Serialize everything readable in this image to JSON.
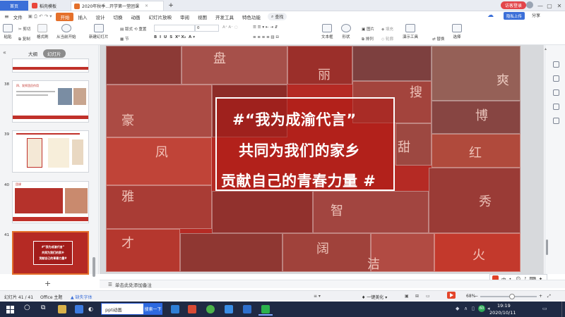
{
  "titlebar": {
    "home_tab": "首页",
    "template_tab": "稻壳模板",
    "doc_tab": "2020年秋季...开学第一堂团课",
    "add_tab": "+",
    "login_label": "访客登录"
  },
  "menubar": {
    "file": "文件",
    "items": [
      "开始",
      "插入",
      "设计",
      "切换",
      "动画",
      "幻灯片放映",
      "审阅",
      "视图",
      "开发工具",
      "特色功能"
    ],
    "search": "查找",
    "cloud": "隐私上传",
    "share": "分享"
  },
  "ribbon": {
    "paste": "粘贴",
    "cut": "剪切",
    "copy": "复制",
    "format_painter": "格式刷",
    "from_start": "从当前开始",
    "new_slide": "新建幻灯片",
    "layout": "版式",
    "section": "节",
    "reset": "重置",
    "font_size": "0",
    "text_box": "文本框",
    "shape": "形状",
    "arrange": "排列",
    "picture": "图片",
    "fill": "填充",
    "outline": "轮廓",
    "presentation_tools": "演示工具",
    "replace": "替换",
    "select": "选择"
  },
  "left_panel": {
    "outline_tab": "大纲",
    "slides_tab": "幻灯片",
    "slide_numbers": [
      "38",
      "39",
      "40",
      "41"
    ],
    "thumb38_title": "四、发挥团员作用",
    "thumb40_title": "团课",
    "thumb41_lines": [
      "#“我为成渝代言”",
      "共同为我们的家乡",
      "贡献自己的青春力量#"
    ]
  },
  "slide": {
    "line1": "#“我为成渝代言”",
    "line2": "共同为我们的家乡",
    "line3": "贡献自己的青春力量 #",
    "tile_chars": [
      "盘",
      "丽",
      "搜",
      "爽",
      "豪",
      "博",
      "凤",
      "甜",
      "红",
      "雅",
      "智",
      "秀",
      "才",
      "阔",
      "洁",
      "火"
    ]
  },
  "notes": {
    "placeholder": "单击此处添加备注"
  },
  "statusbar": {
    "slide_count": "幻灯片 41 / 41",
    "theme": "Office 主题",
    "missing_font": "缺失字体",
    "beautify": "一键美化",
    "zoom": "68%"
  },
  "ime": {
    "label": "中"
  },
  "taskbar": {
    "search_text": "ppt动画",
    "search_button": "搜索一下",
    "time": "19:19",
    "date": "2020/10/11",
    "tray_badge": "60"
  },
  "colors": {
    "accent": "#e4702b",
    "slide_red": "#b52a24",
    "taskbar": "#1f2a44"
  }
}
